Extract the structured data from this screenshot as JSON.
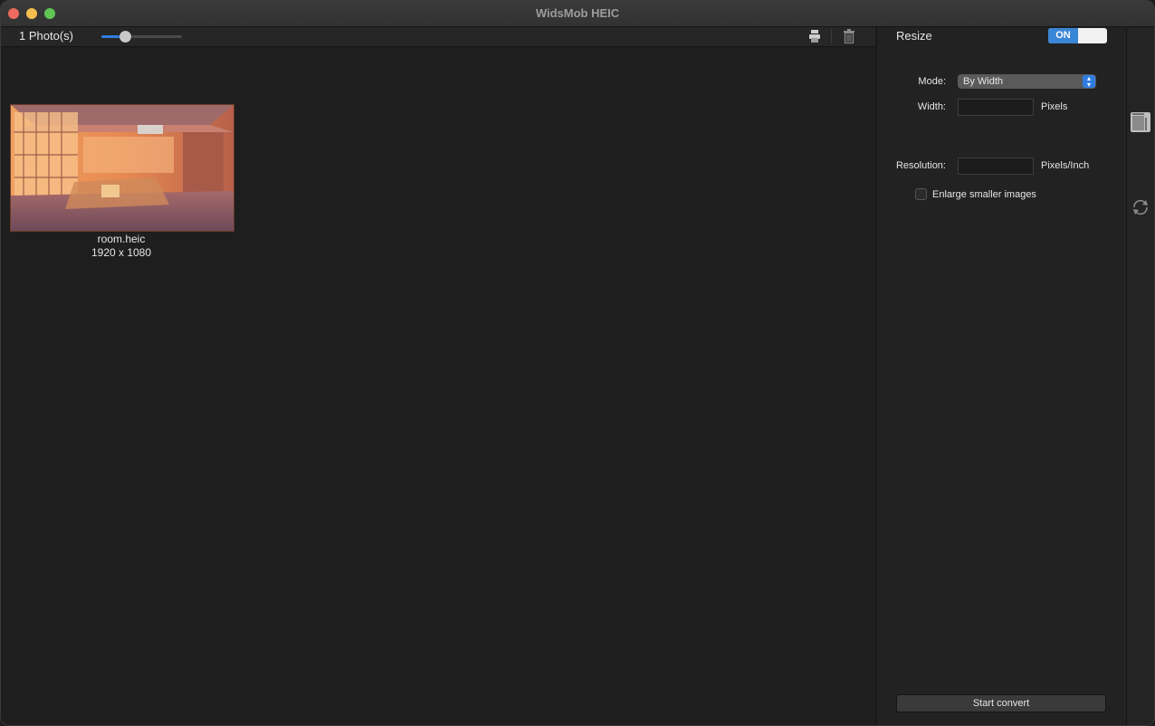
{
  "window": {
    "title": "WidsMob HEIC"
  },
  "toolbar": {
    "photo_count": "1 Photo(s)",
    "zoom_level": 0.3,
    "icons": [
      "printer-icon",
      "trash-icon"
    ]
  },
  "photos": [
    {
      "filename": "room.heic",
      "dimensions": "1920 x 1080"
    }
  ],
  "resize_panel": {
    "title": "Resize",
    "toggle_label": "ON",
    "mode_label": "Mode:",
    "mode_value": "By Width",
    "width_label": "Width:",
    "width_value": "",
    "width_unit": "Pixels",
    "resolution_label": "Resolution:",
    "resolution_value": "",
    "resolution_unit": "Pixels/Inch",
    "enlarge_label": "Enlarge smaller images",
    "enlarge_checked": false,
    "start_button": "Start convert"
  },
  "side_strip": {
    "icons": [
      "resize-tool-icon",
      "rotate-tool-icon"
    ]
  },
  "colors": {
    "accent": "#2f7de1",
    "toggle_on": "#3a86d6",
    "background": "#1e1e1e"
  }
}
